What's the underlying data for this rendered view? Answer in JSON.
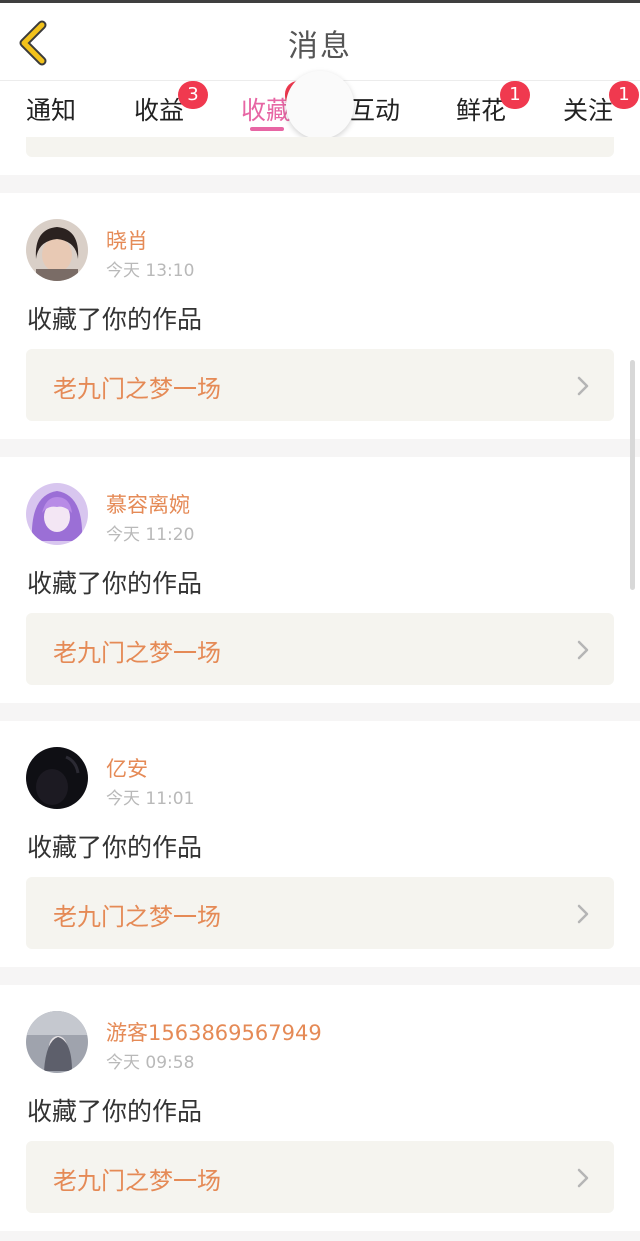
{
  "header": {
    "title": "消息"
  },
  "tabs": [
    {
      "label": "通知",
      "badge": ""
    },
    {
      "label": "收益",
      "badge": "3"
    },
    {
      "label": "收藏",
      "badge": ""
    },
    {
      "label": "互动",
      "badge": ""
    },
    {
      "label": "鲜花",
      "badge": "1"
    },
    {
      "label": "关注",
      "badge": "1"
    }
  ],
  "active_tab": "收藏",
  "colors": {
    "accent": "#e766a4",
    "name": "#e58a56",
    "badge": "#f0394f"
  },
  "items": [
    {
      "name": "晓肖",
      "time": "今天 13:10",
      "action": "收藏了你的作品",
      "work": "老九门之梦一场"
    },
    {
      "name": "慕容离婉",
      "time": "今天 11:20",
      "action": "收藏了你的作品",
      "work": "老九门之梦一场"
    },
    {
      "name": "亿安",
      "time": "今天 11:01",
      "action": "收藏了你的作品",
      "work": "老九门之梦一场"
    },
    {
      "name": "游客1563869567949",
      "time": "今天 09:58",
      "action": "收藏了你的作品",
      "work": "老九门之梦一场"
    }
  ]
}
